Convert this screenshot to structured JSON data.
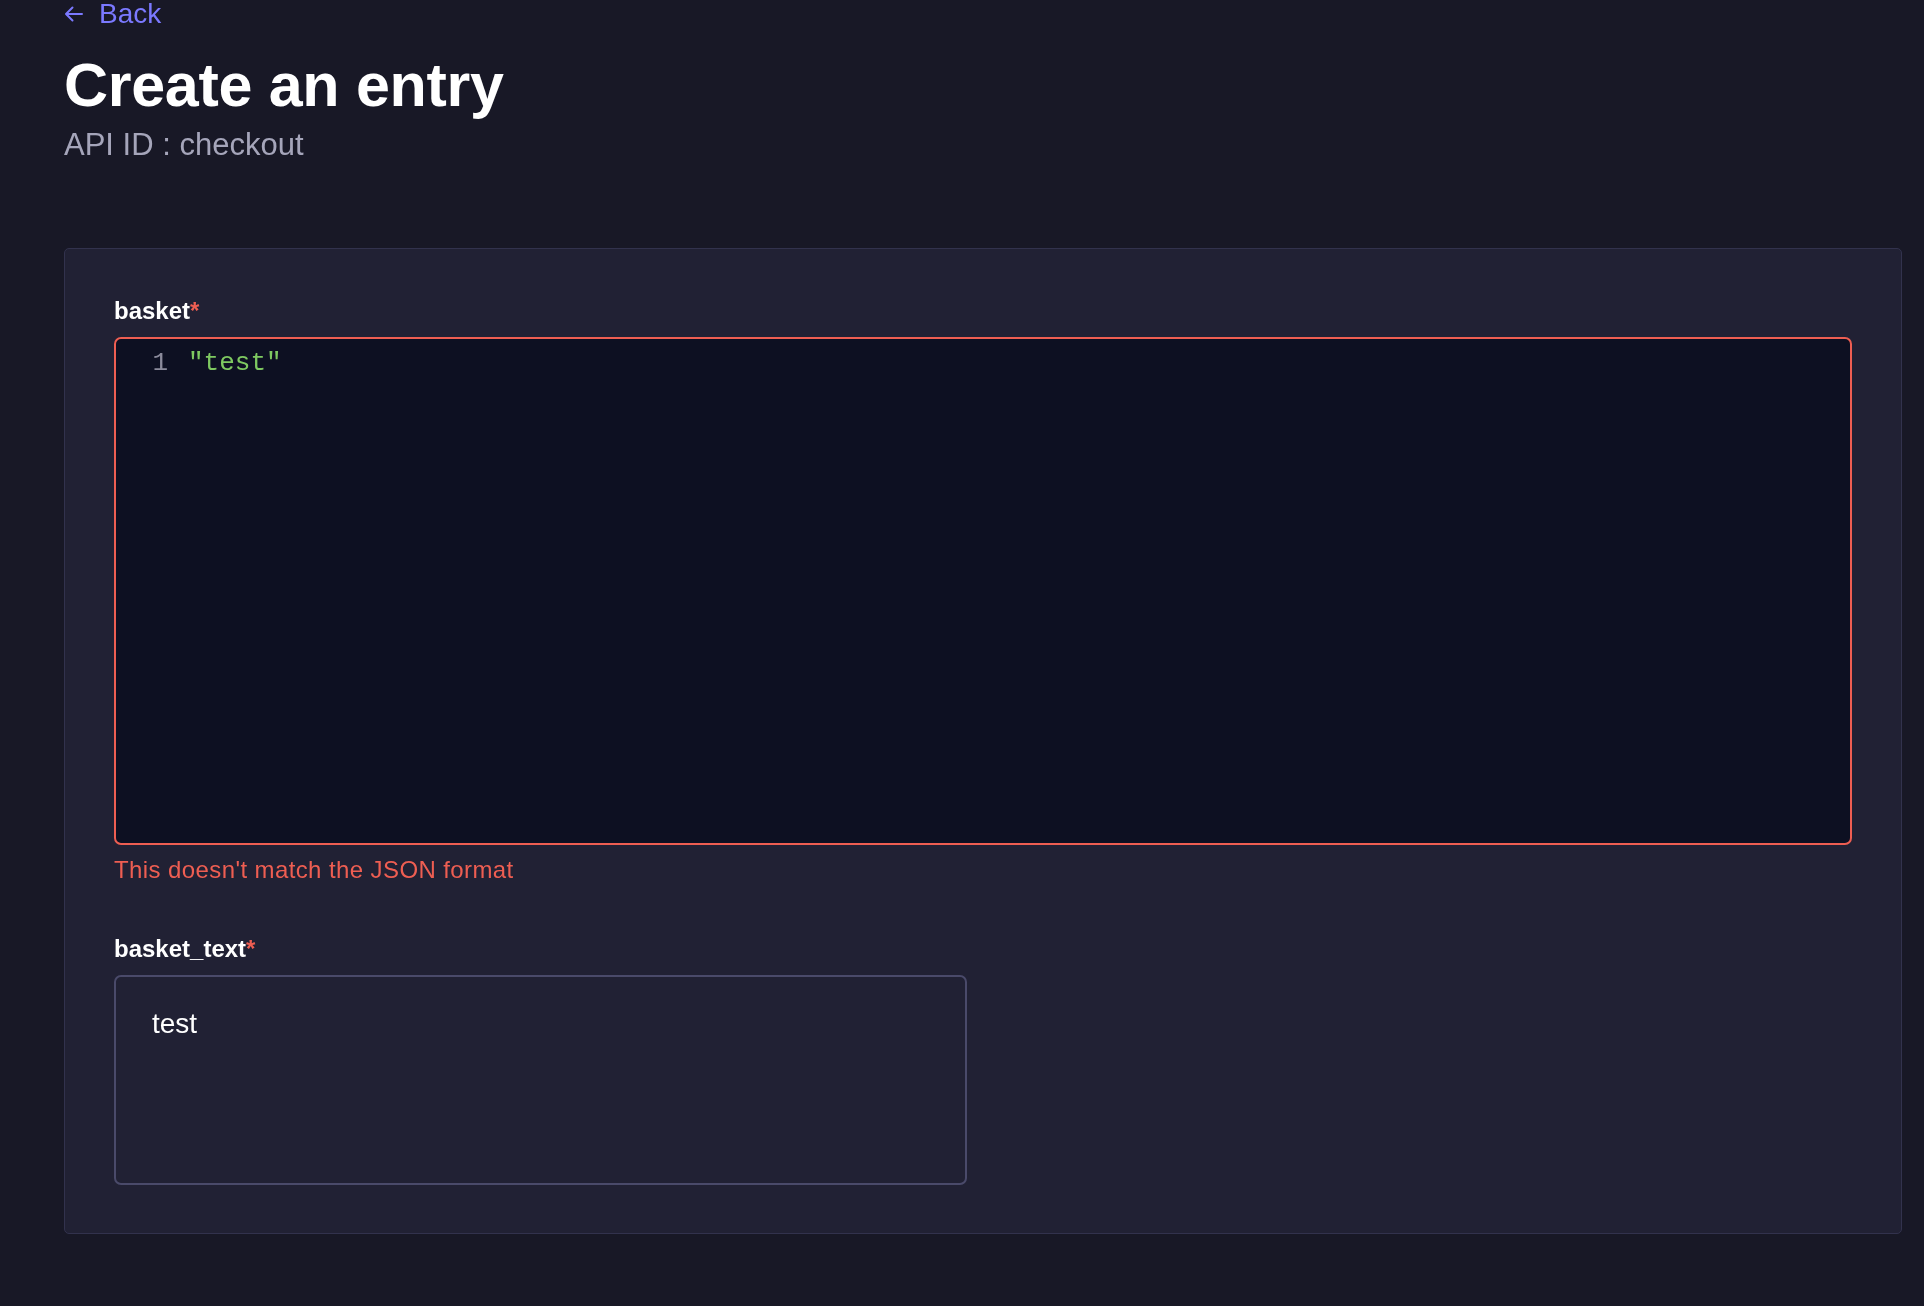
{
  "back_link": {
    "label": "Back"
  },
  "header": {
    "title": "Create an entry",
    "subtitle": "API ID : checkout"
  },
  "fields": [
    {
      "kind": "json",
      "label": "basket",
      "required_mark": "*",
      "invalid": true,
      "lines": [
        {
          "number": "1",
          "tokens": [
            {
              "kind": "string",
              "text": "\"test\""
            }
          ]
        }
      ],
      "error": "This doesn't match the JSON format"
    },
    {
      "kind": "textarea",
      "label": "basket_text",
      "required_mark": "*",
      "invalid": false,
      "value": "test"
    }
  ]
}
